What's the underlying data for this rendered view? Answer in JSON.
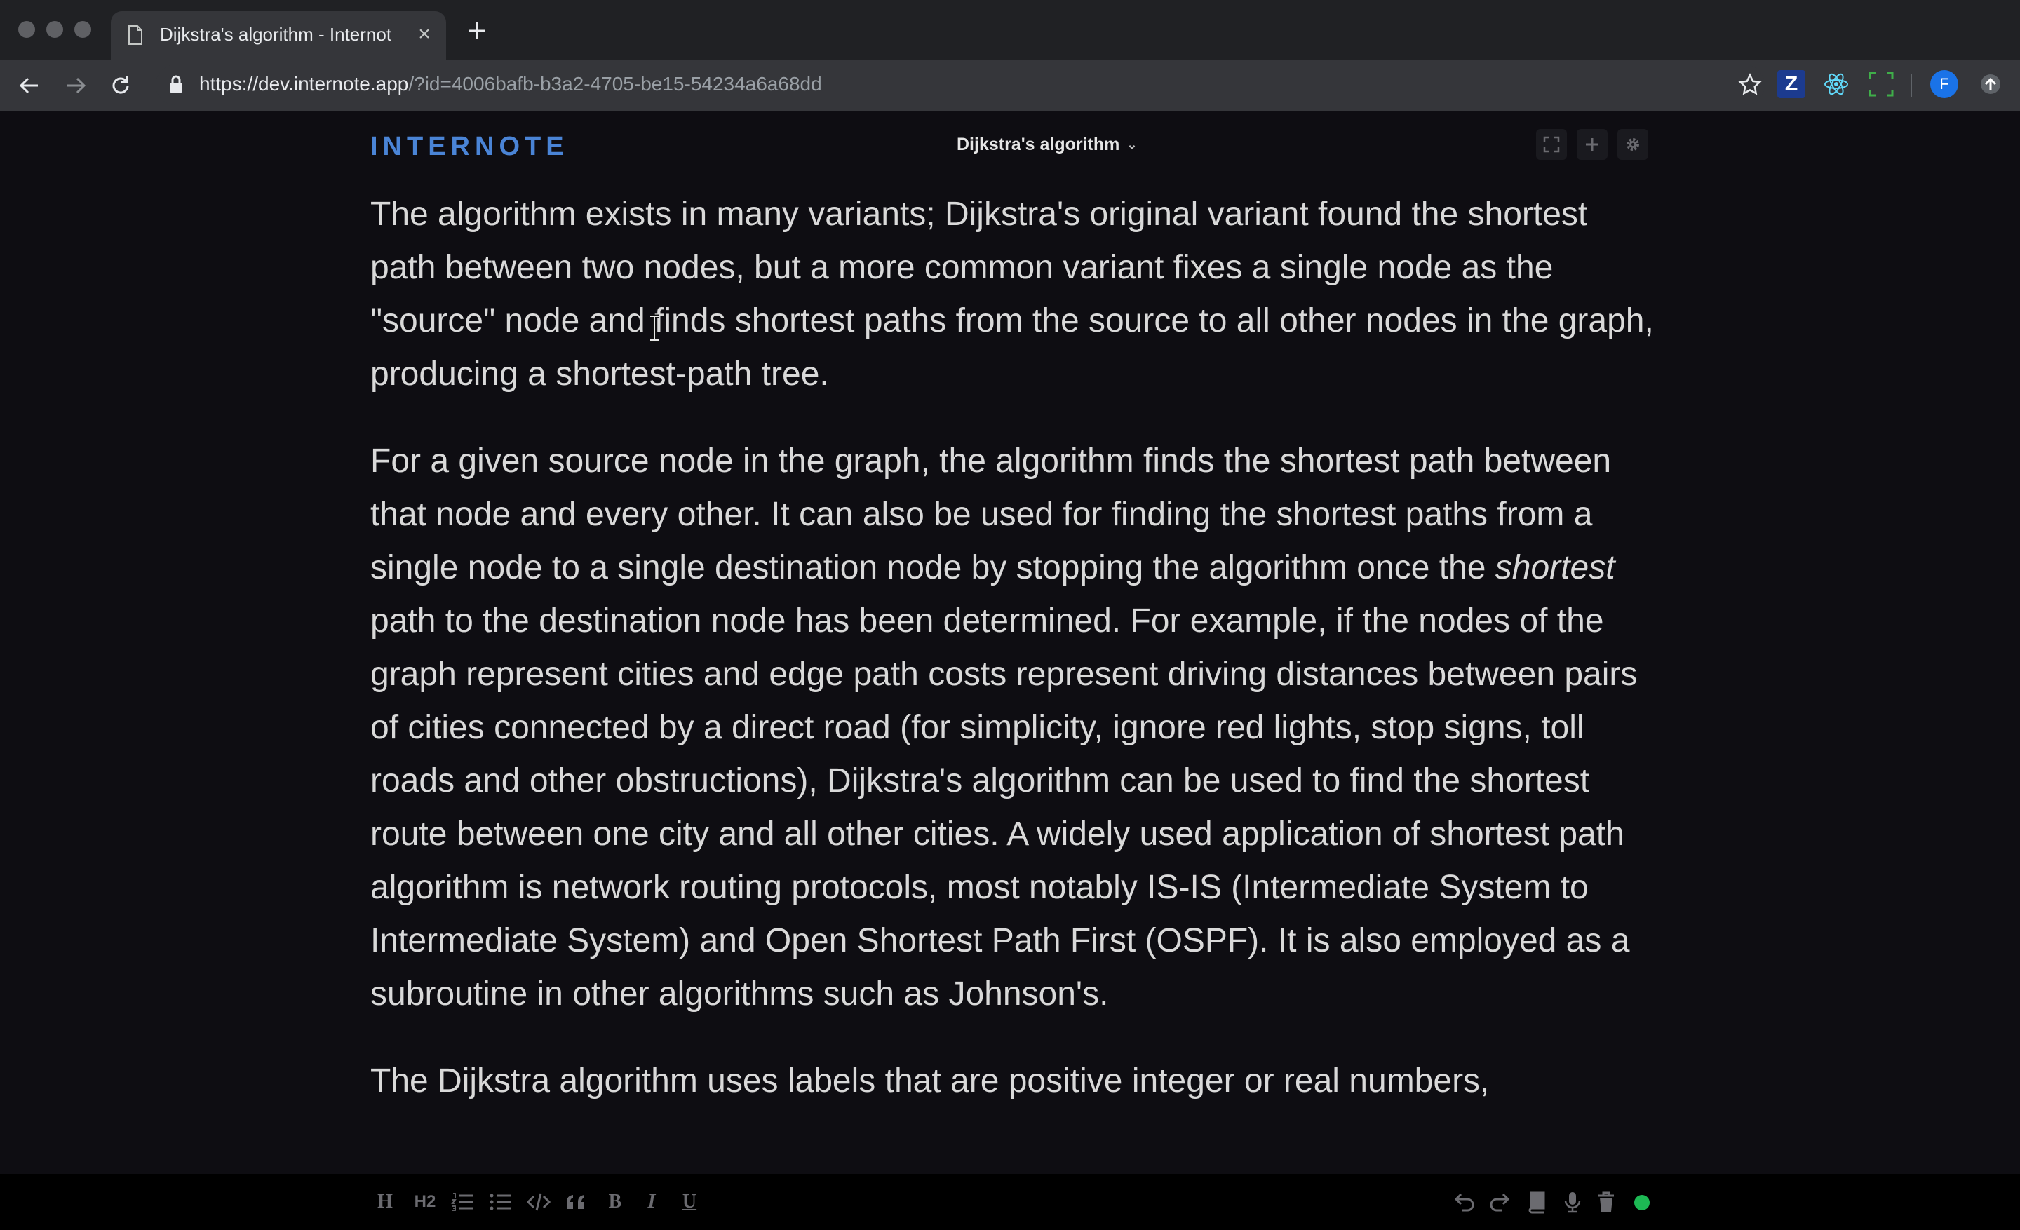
{
  "browser": {
    "tab_title": "Dijkstra's algorithm - Internote",
    "tab_close": "×",
    "url_host": "https://dev.internote.app",
    "url_path": "/?id=4006bafb-b3a2-4705-be15-54234a6a68dd",
    "profile_initial": "F",
    "extension_z_label": "Z"
  },
  "app": {
    "logo": "INTERNOTE",
    "note_title": "Dijkstra's algorithm",
    "note_title_caret": "⌄",
    "toolbar_icons": [
      "fullscreen-icon",
      "plus-icon",
      "gear-icon"
    ]
  },
  "content": {
    "p1": "The algorithm exists in many variants; Dijkstra's original variant found the shortest path between two nodes, but a more common variant fixes a single node as the \"source\" node and finds shortest paths from the source to all other nodes in the graph, producing a shortest-path tree.",
    "p2_before": "For a given source node in the graph, the algorithm finds the shortest path between that node and every other. It can also be used for finding the shortest paths from a single node to a single destination node by stopping the algorithm once the ",
    "p2_em": "shortest",
    "p2_after": " path to the destination node has been determined. For example, if the nodes of the graph represent cities and edge path costs represent driving distances between pairs of cities connected by a direct road (for simplicity, ignore red lights, stop signs, toll roads and other obstructions), Dijkstra's algorithm can be used to find the shortest route between one city and all other cities. A widely used application of shortest path algorithm is network routing protocols, most notably IS-IS (Intermediate System to Intermediate System) and Open Shortest Path First (OSPF). It is also employed as a subroutine in other algorithms such as Johnson's.",
    "p3": "The Dijkstra algorithm uses labels that are positive integer or real numbers,"
  },
  "editor_toolbar": {
    "heading": "H",
    "heading2": "H2",
    "bold": "B",
    "italic": "I",
    "underline": "U"
  },
  "colors": {
    "status_connected": "#1db954",
    "profile_avatar": "#1a73e8",
    "logo": "#4a84d6"
  }
}
